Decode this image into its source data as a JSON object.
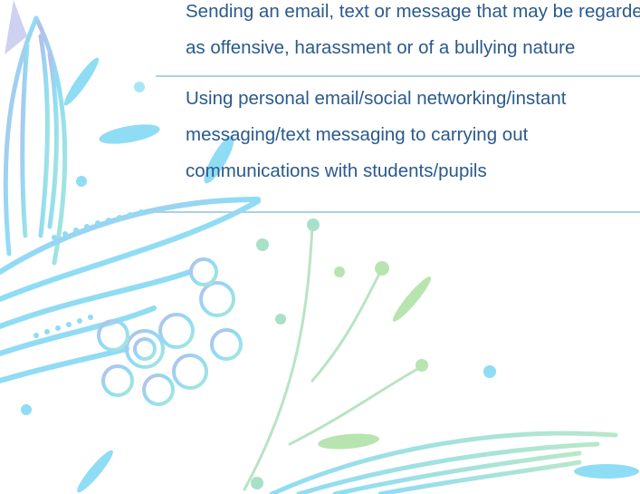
{
  "rows": [
    {
      "lines": [
        "Sending an email, text or message that may be regarded",
        "as offensive, harassment or of a bullying nature"
      ]
    },
    {
      "lines": [
        "Using personal email/social networking/instant",
        "messaging/text messaging to carrying out",
        "communications with students/pupils"
      ]
    }
  ],
  "colors": {
    "text": "#2a5a8c",
    "divider": "#a9d2e4",
    "decor_blue": "#8fdcf5",
    "decor_green": "#a8dcb8",
    "decor_purple": "#b9bde8"
  }
}
